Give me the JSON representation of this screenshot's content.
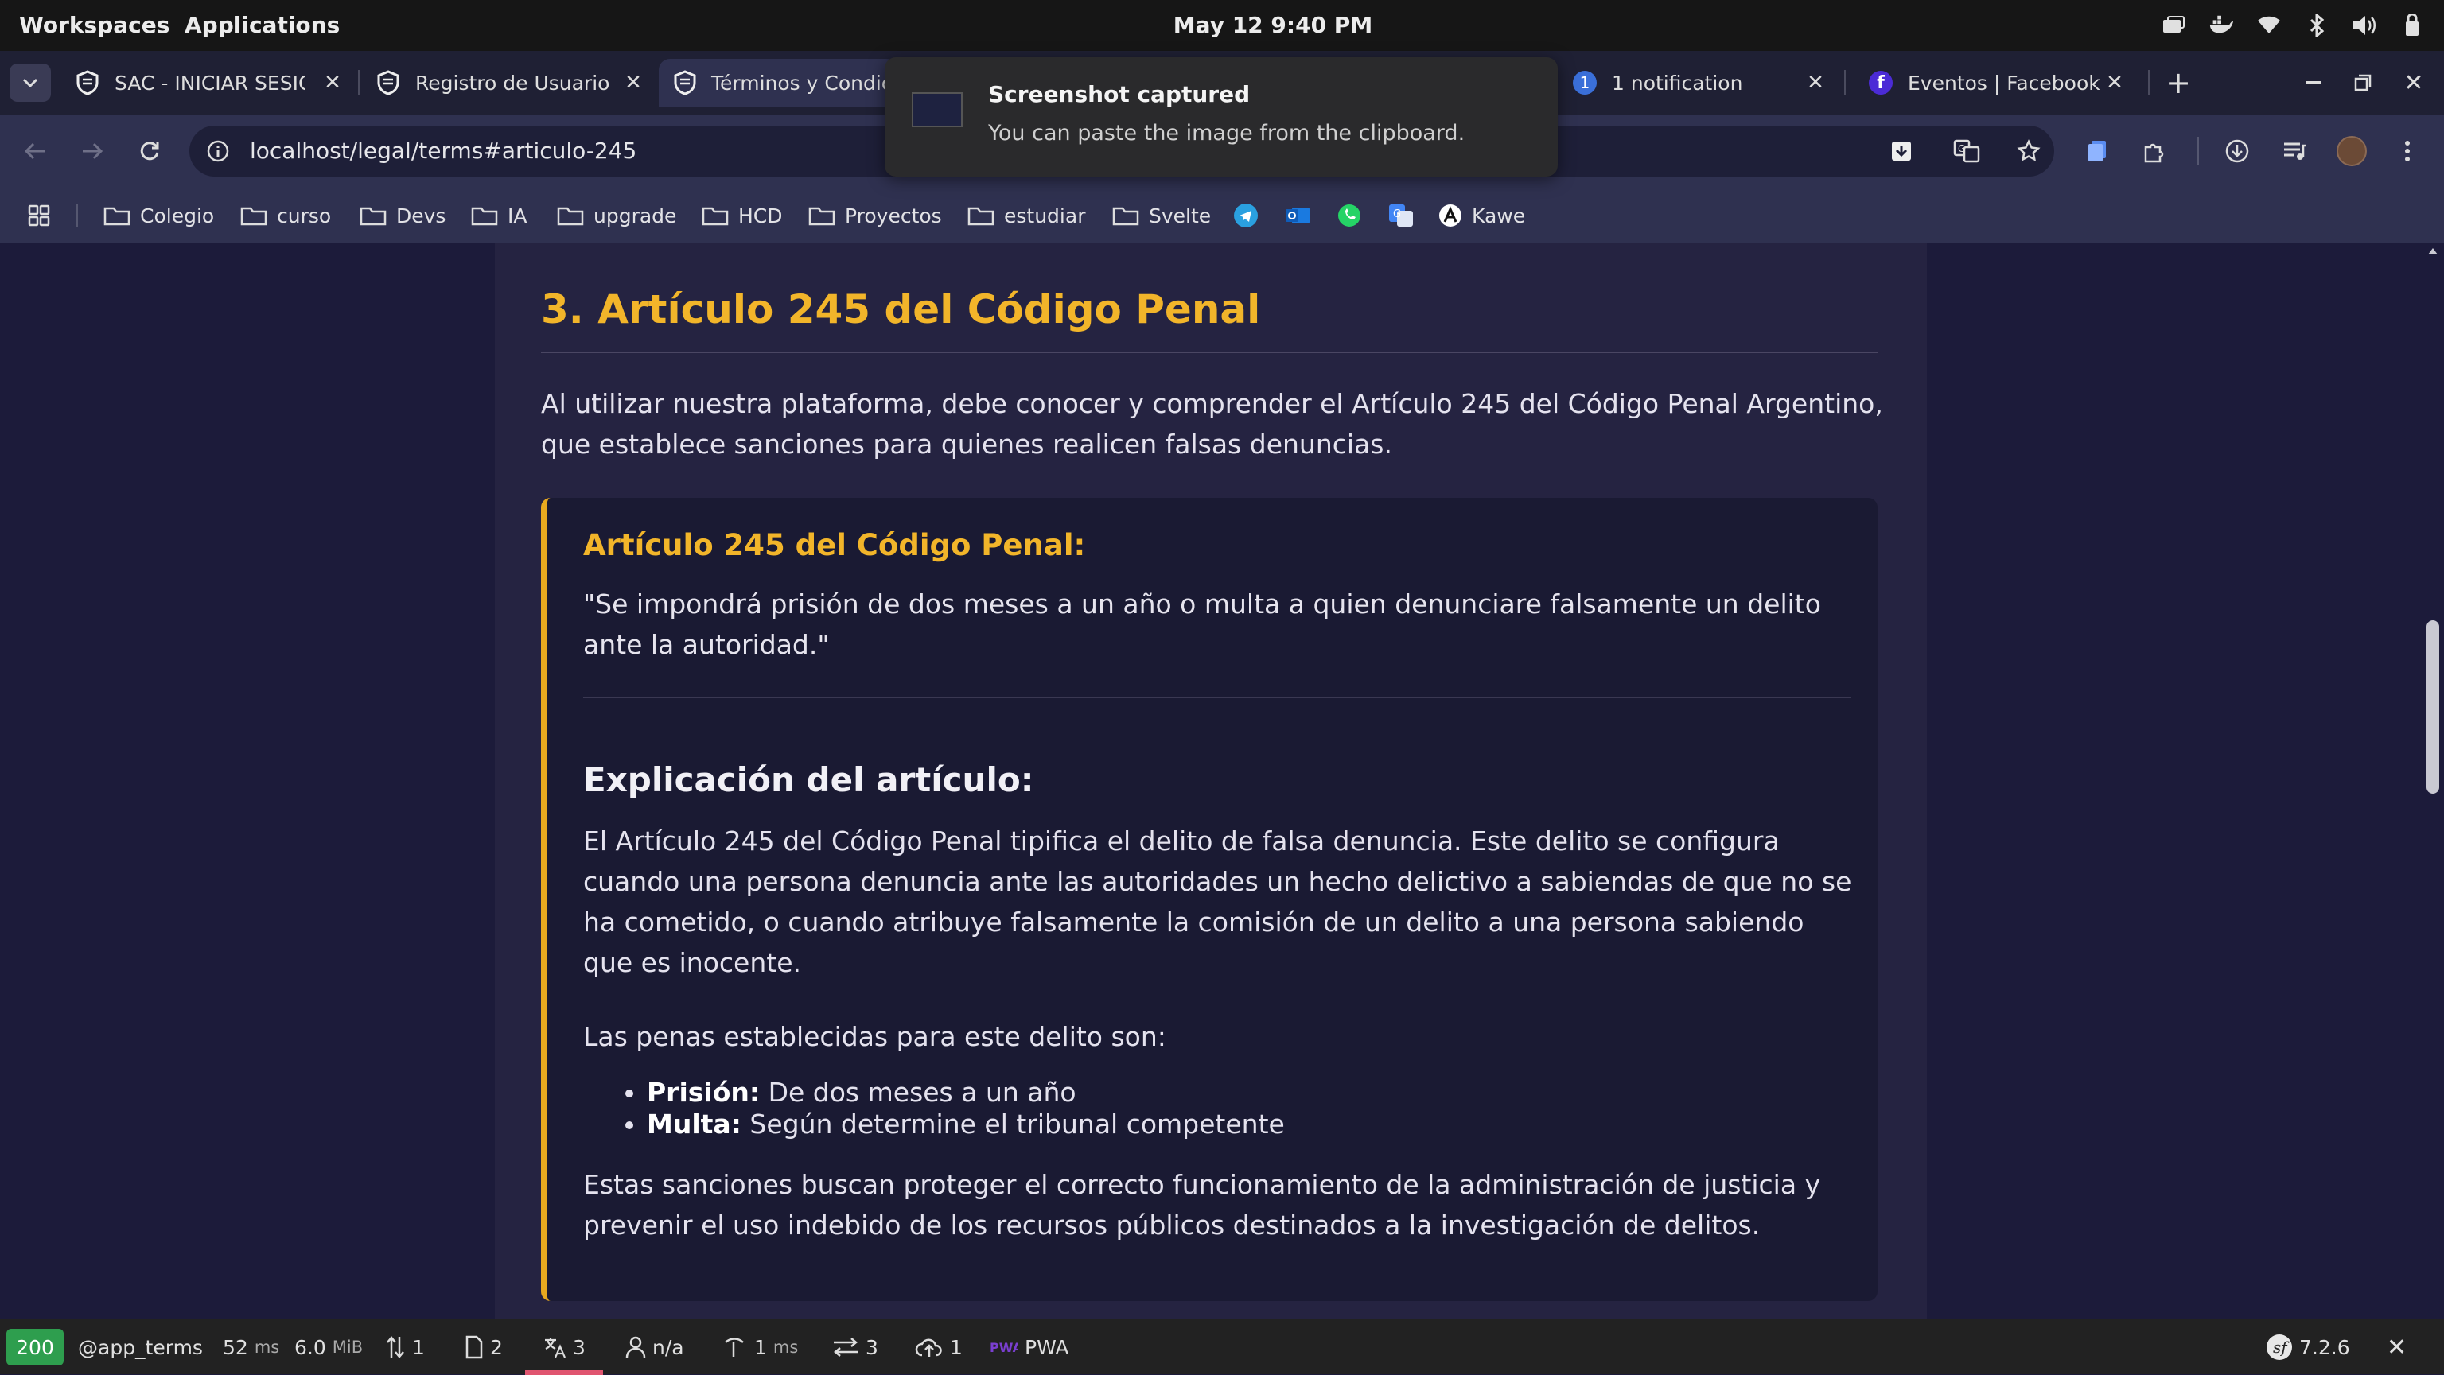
{
  "system_bar": {
    "workspaces": "Workspaces",
    "applications": "Applications",
    "clock": "May 12  9:40 PM"
  },
  "tabs": [
    {
      "title": "SAC - INICIAR SESIÓN",
      "icon": "shield-icon"
    },
    {
      "title": "Registro de Usuario",
      "icon": "shield-icon"
    },
    {
      "title": "Términos y Condic",
      "icon": "shield-icon"
    },
    {
      "title": "1 notification",
      "icon": "notification-badge-icon",
      "badge": "1"
    },
    {
      "title": "Eventos | Facebook",
      "icon": "facebook-icon"
    }
  ],
  "address": {
    "url": "localhost/legal/terms#articulo-245"
  },
  "bookmarks": [
    {
      "label": "Colegio"
    },
    {
      "label": "curso"
    },
    {
      "label": "Devs"
    },
    {
      "label": "IA"
    },
    {
      "label": "upgrade"
    },
    {
      "label": "HCD"
    },
    {
      "label": "Proyectos"
    },
    {
      "label": "estudiar"
    },
    {
      "label": "Svelte"
    },
    {
      "label": "Kawe"
    }
  ],
  "toast": {
    "title": "Screenshot captured",
    "message": "You can paste the image from the clipboard."
  },
  "article": {
    "heading": "3. Artículo 245 del Código Penal",
    "intro": "Al utilizar nuestra plataforma, debe conocer y comprender el Artículo 245 del Código Penal Argentino, que establece sanciones para quienes realicen falsas denuncias.",
    "box_title": "Artículo 245 del Código Penal:",
    "quote": "\"Se impondrá prisión de dos meses a un año o multa a quien denunciare falsamente un delito ante la autoridad.\"",
    "explanation_heading": "Explicación del artículo:",
    "explanation": "El Artículo 245 del Código Penal tipifica el delito de falsa denuncia. Este delito se configura cuando una persona denuncia ante las autoridades un hecho delictivo a sabiendas de que no se ha cometido, o cuando atribuye falsamente la comisión de un delito a una persona sabiendo que es inocente.",
    "penalties_intro": "Las penas establecidas para este delito son:",
    "penalties": [
      {
        "label": "Prisión:",
        "text": "De dos meses a un año"
      },
      {
        "label": "Multa:",
        "text": "Según determine el tribunal competente"
      }
    ],
    "closing": "Estas sanciones buscan proteger el correcto funcionamiento de la administración de justicia y prevenir el uso indebido de los recursos públicos destinados a la investigación de delitos."
  },
  "debug_toolbar": {
    "status": "200",
    "route": "@app_terms",
    "time_value": "52",
    "time_unit": "ms",
    "memory_value": "6.0",
    "memory_unit": "MiB",
    "requests": "1",
    "forms": "2",
    "translations": "3",
    "user": "n/a",
    "twig_value": "1",
    "twig_unit": "ms",
    "events": "3",
    "uploads": "1",
    "pwa": "PWA",
    "version": "7.2.6"
  },
  "colors": {
    "accent": "#f2b52a",
    "background": "#1c1b3a",
    "card": "#252341",
    "status_ok": "#2e9e4e"
  }
}
